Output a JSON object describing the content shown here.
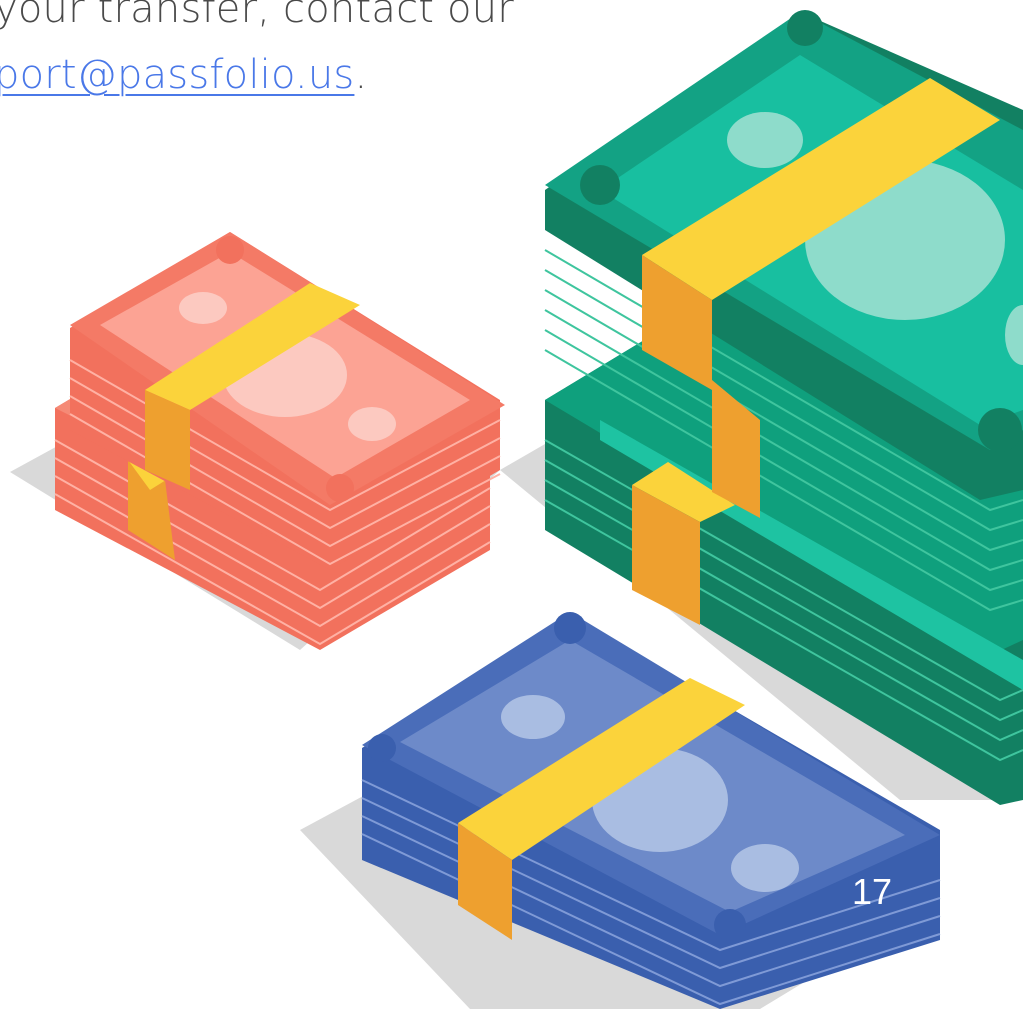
{
  "text": {
    "line1": "your transfer, contact our",
    "email_link": "port@passfolio.us",
    "trailing_punctuation": "."
  },
  "page": {
    "number": "17"
  },
  "illustration": {
    "subject": "stacks of banknotes",
    "colors": {
      "red": "#f47a66",
      "green": "#13a284",
      "blue": "#4a6db9",
      "band_yellow": "#fbd33b",
      "band_orange": "#eea02f",
      "shadow": "#d9d9d9"
    }
  }
}
